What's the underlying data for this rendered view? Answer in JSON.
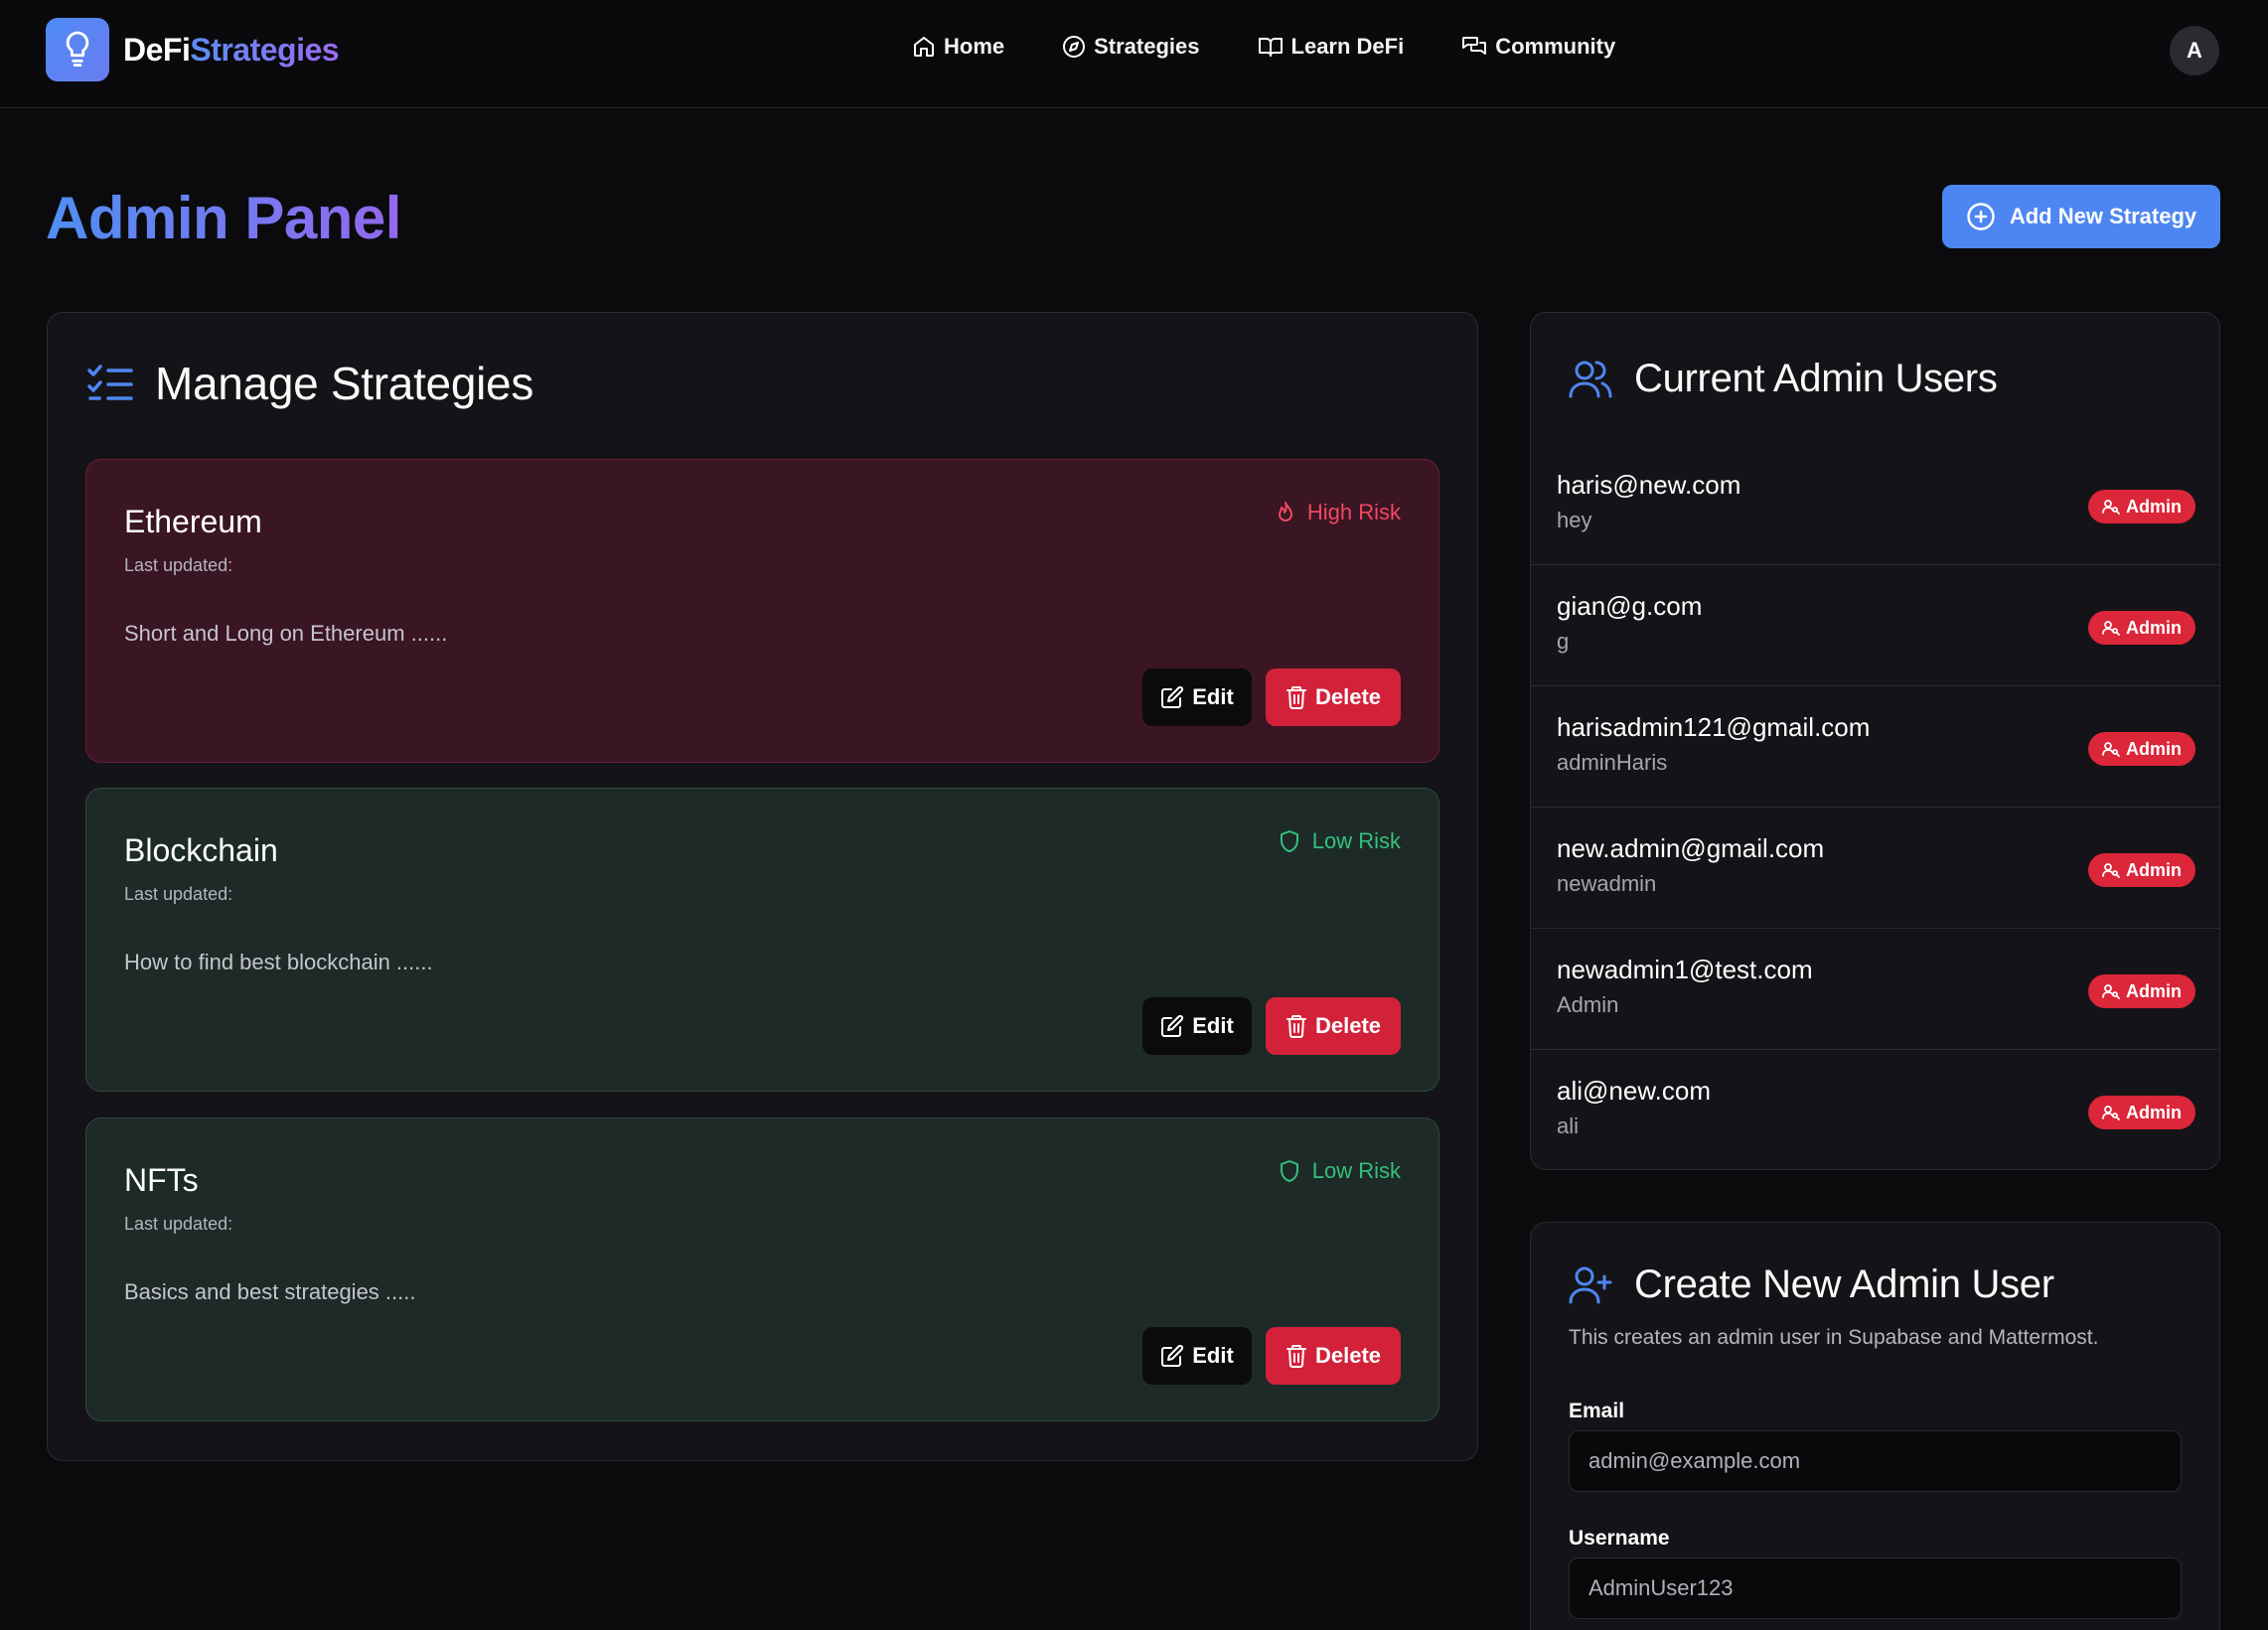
{
  "brand": {
    "name_part1": "DeFi",
    "name_part2": "Strategies"
  },
  "nav": [
    {
      "label": "Home",
      "icon": "home-icon"
    },
    {
      "label": "Strategies",
      "icon": "compass-icon"
    },
    {
      "label": "Learn DeFi",
      "icon": "book-icon"
    },
    {
      "label": "Community",
      "icon": "chat-icon"
    }
  ],
  "user": {
    "avatar_initial": "A"
  },
  "page": {
    "title": "Admin Panel",
    "add_button": "Add New Strategy"
  },
  "manage": {
    "title": "Manage Strategies",
    "cards": [
      {
        "name": "Ethereum",
        "updated": "Last updated:",
        "description": "Short and Long on Ethereum ......",
        "risk": "High Risk",
        "risk_level": "high",
        "edit": "Edit",
        "delete": "Delete"
      },
      {
        "name": "Blockchain",
        "updated": "Last updated:",
        "description": "How to find best blockchain ......",
        "risk": "Low Risk",
        "risk_level": "low",
        "edit": "Edit",
        "delete": "Delete"
      },
      {
        "name": "NFTs",
        "updated": "Last updated:",
        "description": "Basics and best strategies .....",
        "risk": "Low Risk",
        "risk_level": "low",
        "edit": "Edit",
        "delete": "Delete"
      }
    ]
  },
  "admins": {
    "title": "Current Admin Users",
    "users": [
      {
        "email": "haris@new.com",
        "username": "hey",
        "badge": "Admin"
      },
      {
        "email": "gian@g.com",
        "username": "g",
        "badge": "Admin"
      },
      {
        "email": "harisadmin121@gmail.com",
        "username": "adminHaris",
        "badge": "Admin"
      },
      {
        "email": "new.admin@gmail.com",
        "username": "newadmin",
        "badge": "Admin"
      },
      {
        "email": "newadmin1@test.com",
        "username": "Admin",
        "badge": "Admin"
      },
      {
        "email": "ali@new.com",
        "username": "ali",
        "badge": "Admin"
      }
    ]
  },
  "create": {
    "title": "Create New Admin User",
    "subtitle": "This creates an admin user in Supabase and Mattermost.",
    "email_label": "Email",
    "email_placeholder": "admin@example.com",
    "username_label": "Username",
    "username_placeholder": "AdminUser123"
  },
  "colors": {
    "accent": "#4d86f2",
    "danger": "#d4213a",
    "high_risk": "#f0485f",
    "low_risk": "#34c07c",
    "background": "#0b0b0e"
  }
}
